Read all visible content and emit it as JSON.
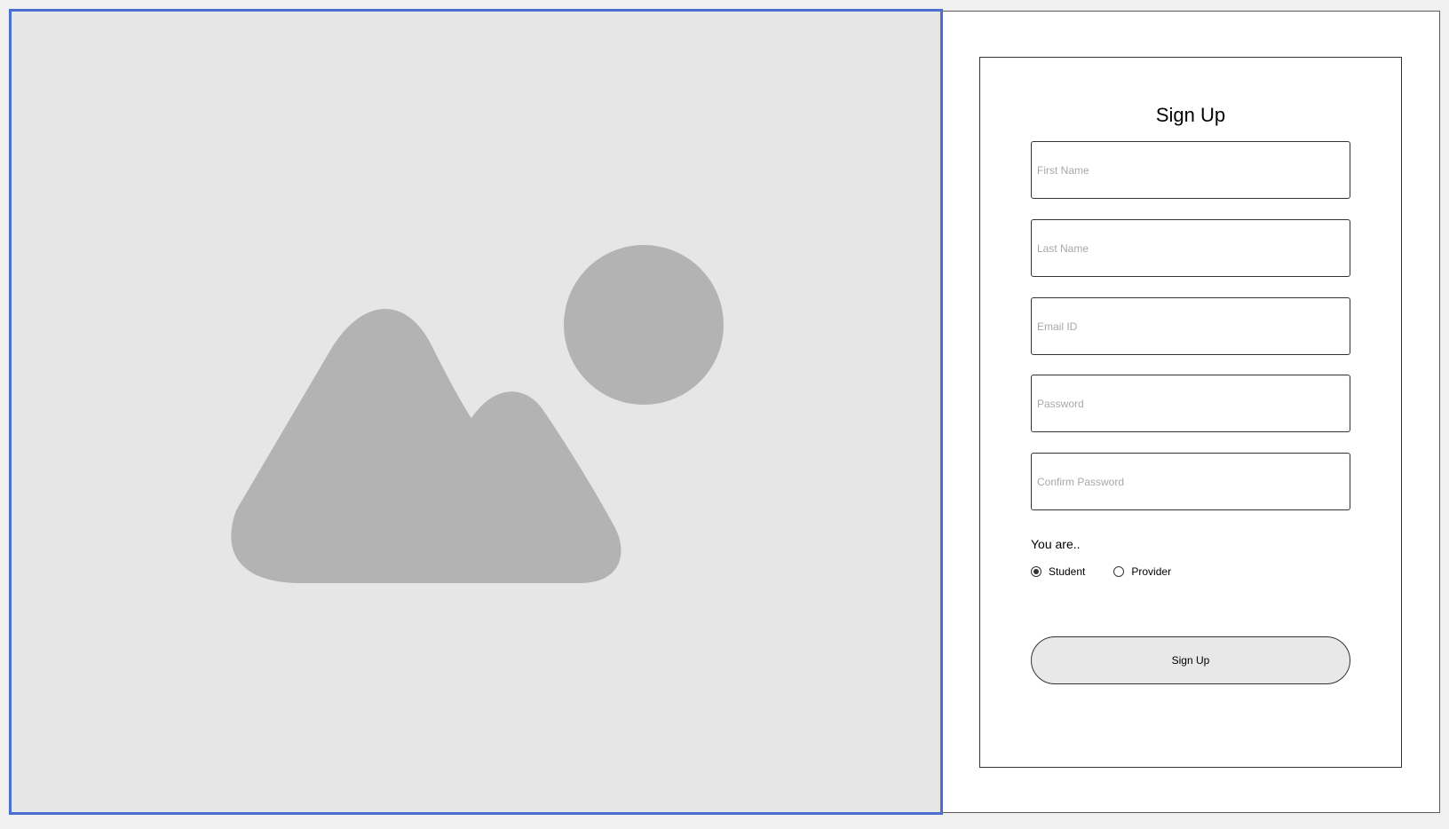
{
  "form": {
    "title": "Sign Up",
    "fields": {
      "first_name": {
        "placeholder": "First Name"
      },
      "last_name": {
        "placeholder": "Last Name"
      },
      "email": {
        "placeholder": "Email ID"
      },
      "password": {
        "placeholder": "Password"
      },
      "confirm_password": {
        "placeholder": "Confirm Password"
      }
    },
    "role_label": "You are..",
    "roles": [
      {
        "label": "Student",
        "selected": true
      },
      {
        "label": "Provider",
        "selected": false
      }
    ],
    "submit_label": "Sign Up"
  },
  "image_placeholder": {
    "icon": "image-placeholder-icon",
    "background_color": "#e6e6e6",
    "shape_color": "#b3b3b3",
    "border_color": "#4a6fd1"
  }
}
